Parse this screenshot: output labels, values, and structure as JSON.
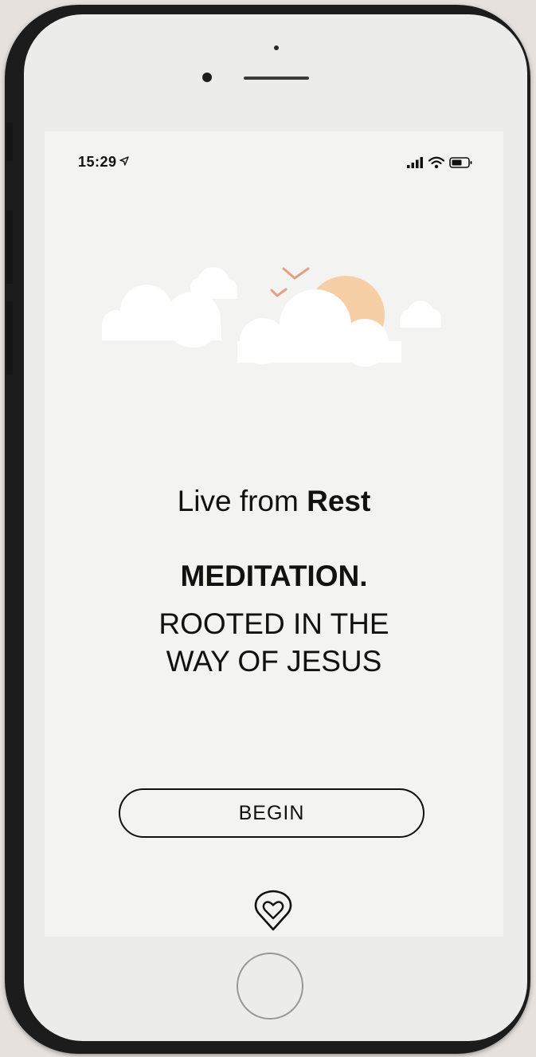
{
  "status_bar": {
    "time": "15:29"
  },
  "welcome": {
    "tagline_prefix": "Live from ",
    "tagline_bold": "Rest",
    "headline": "MEDITATION.",
    "subline_1": "ROOTED IN THE",
    "subline_2": "WAY OF JESUS"
  },
  "actions": {
    "begin_label": "BEGIN"
  },
  "icons": {
    "status": [
      "location-arrow-icon",
      "signal-bars-icon",
      "wifi-icon",
      "battery-icon"
    ],
    "illustration": [
      "cloud-icon",
      "sun-icon",
      "bird-icon"
    ],
    "brand": "heart-pin-logo-icon"
  },
  "colors": {
    "screen_background": "#f3f3f2",
    "sun": "#f6cfa6",
    "birds": "#e5a07f",
    "clouds": "#ffffff",
    "text": "#111111",
    "phone_frame": "#1c1c1c"
  }
}
